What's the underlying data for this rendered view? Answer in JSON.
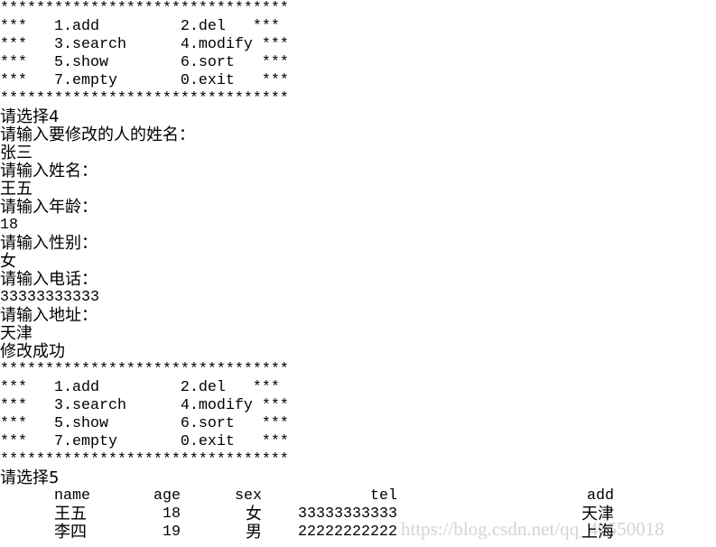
{
  "menu": {
    "border": "********************************",
    "rows": [
      "***   1.add         2.del   ***",
      "***   3.search      4.modify ***",
      "***   5.show        6.sort   ***",
      "***   7.empty       0.exit   ***"
    ]
  },
  "session1": {
    "choice_prompt": "请选择4",
    "lines": [
      "请输入要修改的人的姓名：",
      "张三",
      "请输入姓名：",
      "王五",
      "请输入年龄：",
      "18",
      "请输入性别：",
      "女",
      "请输入电话：",
      "33333333333",
      "请输入地址：",
      "天津",
      "修改成功"
    ]
  },
  "session2": {
    "choice_prompt": "请选择5"
  },
  "table": {
    "headers": {
      "name": "name",
      "age": "age",
      "sex": "sex",
      "tel": "tel",
      "add": "add"
    },
    "rows": [
      {
        "name": "王五",
        "age": "18",
        "sex": "女",
        "tel": "33333333333",
        "add": "天津"
      },
      {
        "name": "李四",
        "age": "19",
        "sex": "男",
        "tel": "22222222222",
        "add": "上海"
      }
    ]
  },
  "watermark": "https://blog.csdn.net/qq_40550018"
}
